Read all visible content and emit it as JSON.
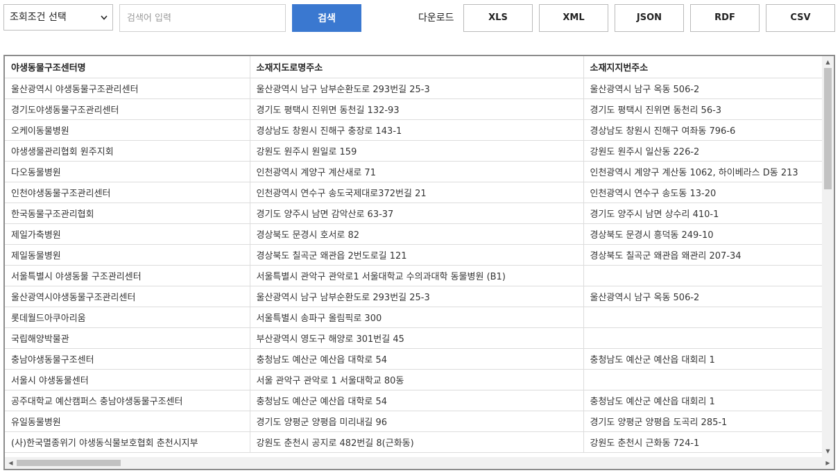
{
  "toolbar": {
    "select_value": "조회조건 선택",
    "search_placeholder": "검색어 입력",
    "search_label": "검색",
    "download_label": "다운로드",
    "formats": [
      "XLS",
      "XML",
      "JSON",
      "RDF",
      "CSV"
    ]
  },
  "table": {
    "columns": [
      "야생동물구조센터명",
      "소재지도로명주소",
      "소재지지번주소"
    ],
    "rows": [
      [
        "울산광역시 야생동물구조관리센터",
        "울산광역시 남구 남부순환도로 293번길 25-3",
        "울산광역시 남구 옥동 506-2"
      ],
      [
        "경기도야생동물구조관리센터",
        "경기도 평택시 진위면 동천길 132-93",
        "경기도 평택시 진위면 동천리 56-3"
      ],
      [
        "오케이동물병원",
        "경상남도 창원시 진해구 충장로 143-1",
        "경상남도 창원시 진해구 여좌동 796-6"
      ],
      [
        "야생생물관리협회 원주지회",
        "강원도 원주시 원일로 159",
        "강원도 원주시 일산동 226-2"
      ],
      [
        "다오동물병원",
        "인천광역시 계양구 계산새로 71",
        "인천광역시 계양구 계산동 1062, 하이베라스 D동 213"
      ],
      [
        "인천야생동물구조관리센터",
        "인천광역시 연수구 송도국제대로372번길 21",
        "인천광역시 연수구 송도동 13-20"
      ],
      [
        "한국동물구조관리협회",
        "경기도 양주시 남면 감악산로 63-37",
        "경기도 양주시 남면 상수리 410-1"
      ],
      [
        "제일가축병원",
        "경상북도 문경시 호서로 82",
        "경상북도 문경시 흥덕동 249-10"
      ],
      [
        "제일동물병원",
        "경상북도 칠곡군 왜관읍 2번도로길 121",
        "경상북도 칠곡군 왜관읍 왜관리 207-34"
      ],
      [
        "서울특별시 야생동물 구조관리센터",
        "서울특별시 관악구 관악로1 서울대학교 수의과대학 동물병원 (B1)",
        ""
      ],
      [
        "울산광역시야생동물구조관리센터",
        "울산광역시 남구 남부순환도로 293번길 25-3",
        "울산광역시 남구 옥동 506-2"
      ],
      [
        "롯데월드아쿠아리움",
        "서울특별시 송파구 올림픽로 300",
        ""
      ],
      [
        "국립해양박물관",
        "부산광역시 영도구 해양로 301번길 45",
        ""
      ],
      [
        "충남야생동물구조센터",
        "충청남도 예산군 예산읍 대학로 54",
        "충청남도 예산군 예산읍 대회리 1"
      ],
      [
        "서울시 야생동물센터",
        "서울 관악구 관악로 1 서울대학교 80동",
        ""
      ],
      [
        "공주대학교 예산캠퍼스 충남야생동물구조센터",
        "충청남도 예산군 예산읍 대학로 54",
        "충청남도 예산군 예산읍 대회리 1"
      ],
      [
        "유일동물병원",
        "경기도 양평군 양평읍 미리내길 96",
        "경기도 양평군 양평읍 도곡리 285-1"
      ],
      [
        "(사)한국멸종위기 야생동식물보호협회 춘천시지부",
        "강원도 춘천시 공지로 482번길 8(근화동)",
        "강원도 춘천시 근화동 724-1"
      ]
    ]
  }
}
